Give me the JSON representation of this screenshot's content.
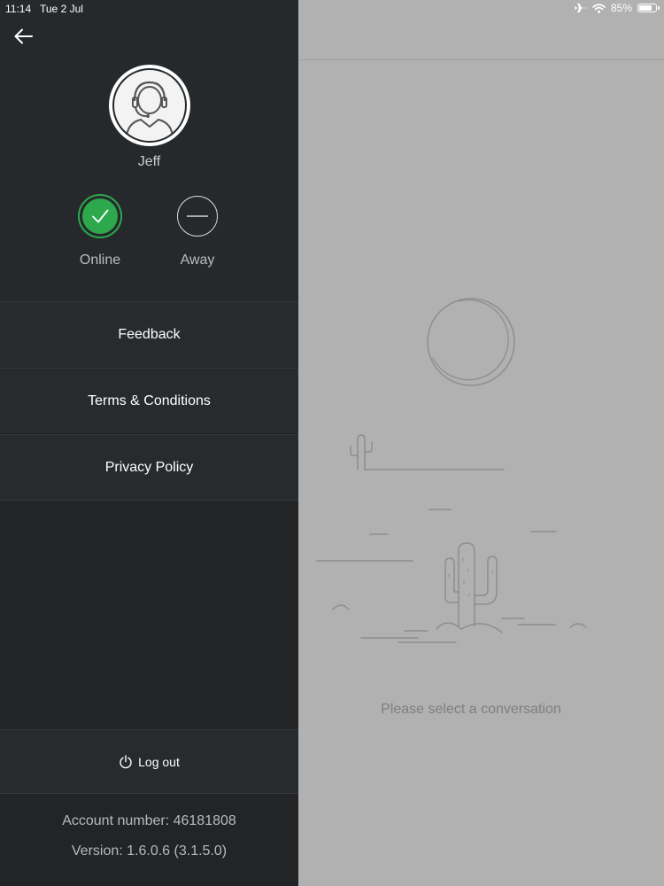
{
  "status_bar": {
    "time": "11:14",
    "date": "Tue 2 Jul",
    "battery": "85%",
    "battery_level": 0.85,
    "icons": [
      "airplane-icon",
      "wifi-icon",
      "battery-icon"
    ]
  },
  "sidebar": {
    "back_icon": "arrow-left-icon",
    "user": {
      "name": "Jeff",
      "avatar_icon": "headset-agent-icon"
    },
    "statuses": [
      {
        "label": "Online",
        "selected": true,
        "color": "#2ea84c",
        "icon": "check-icon"
      },
      {
        "label": "Away",
        "selected": false,
        "icon": "minus-icon"
      }
    ],
    "menu": [
      {
        "label": "Feedback"
      },
      {
        "label": "Terms & Conditions"
      },
      {
        "label": "Privacy Policy"
      }
    ],
    "logout": {
      "label": "Log out",
      "icon": "power-icon"
    },
    "account_number": "Account number: 46181808",
    "version": "Version: 1.6.0.6 (3.1.5.0)"
  },
  "main": {
    "empty_state": {
      "illustration": "desert-cactus-illustration",
      "message": "Please select a conversation"
    }
  },
  "colors": {
    "sidebar_bg": "#222426",
    "menu_bg": "#272b2e",
    "online_green": "#2ea84c",
    "right_pane_bg": "#b1b1b1"
  }
}
